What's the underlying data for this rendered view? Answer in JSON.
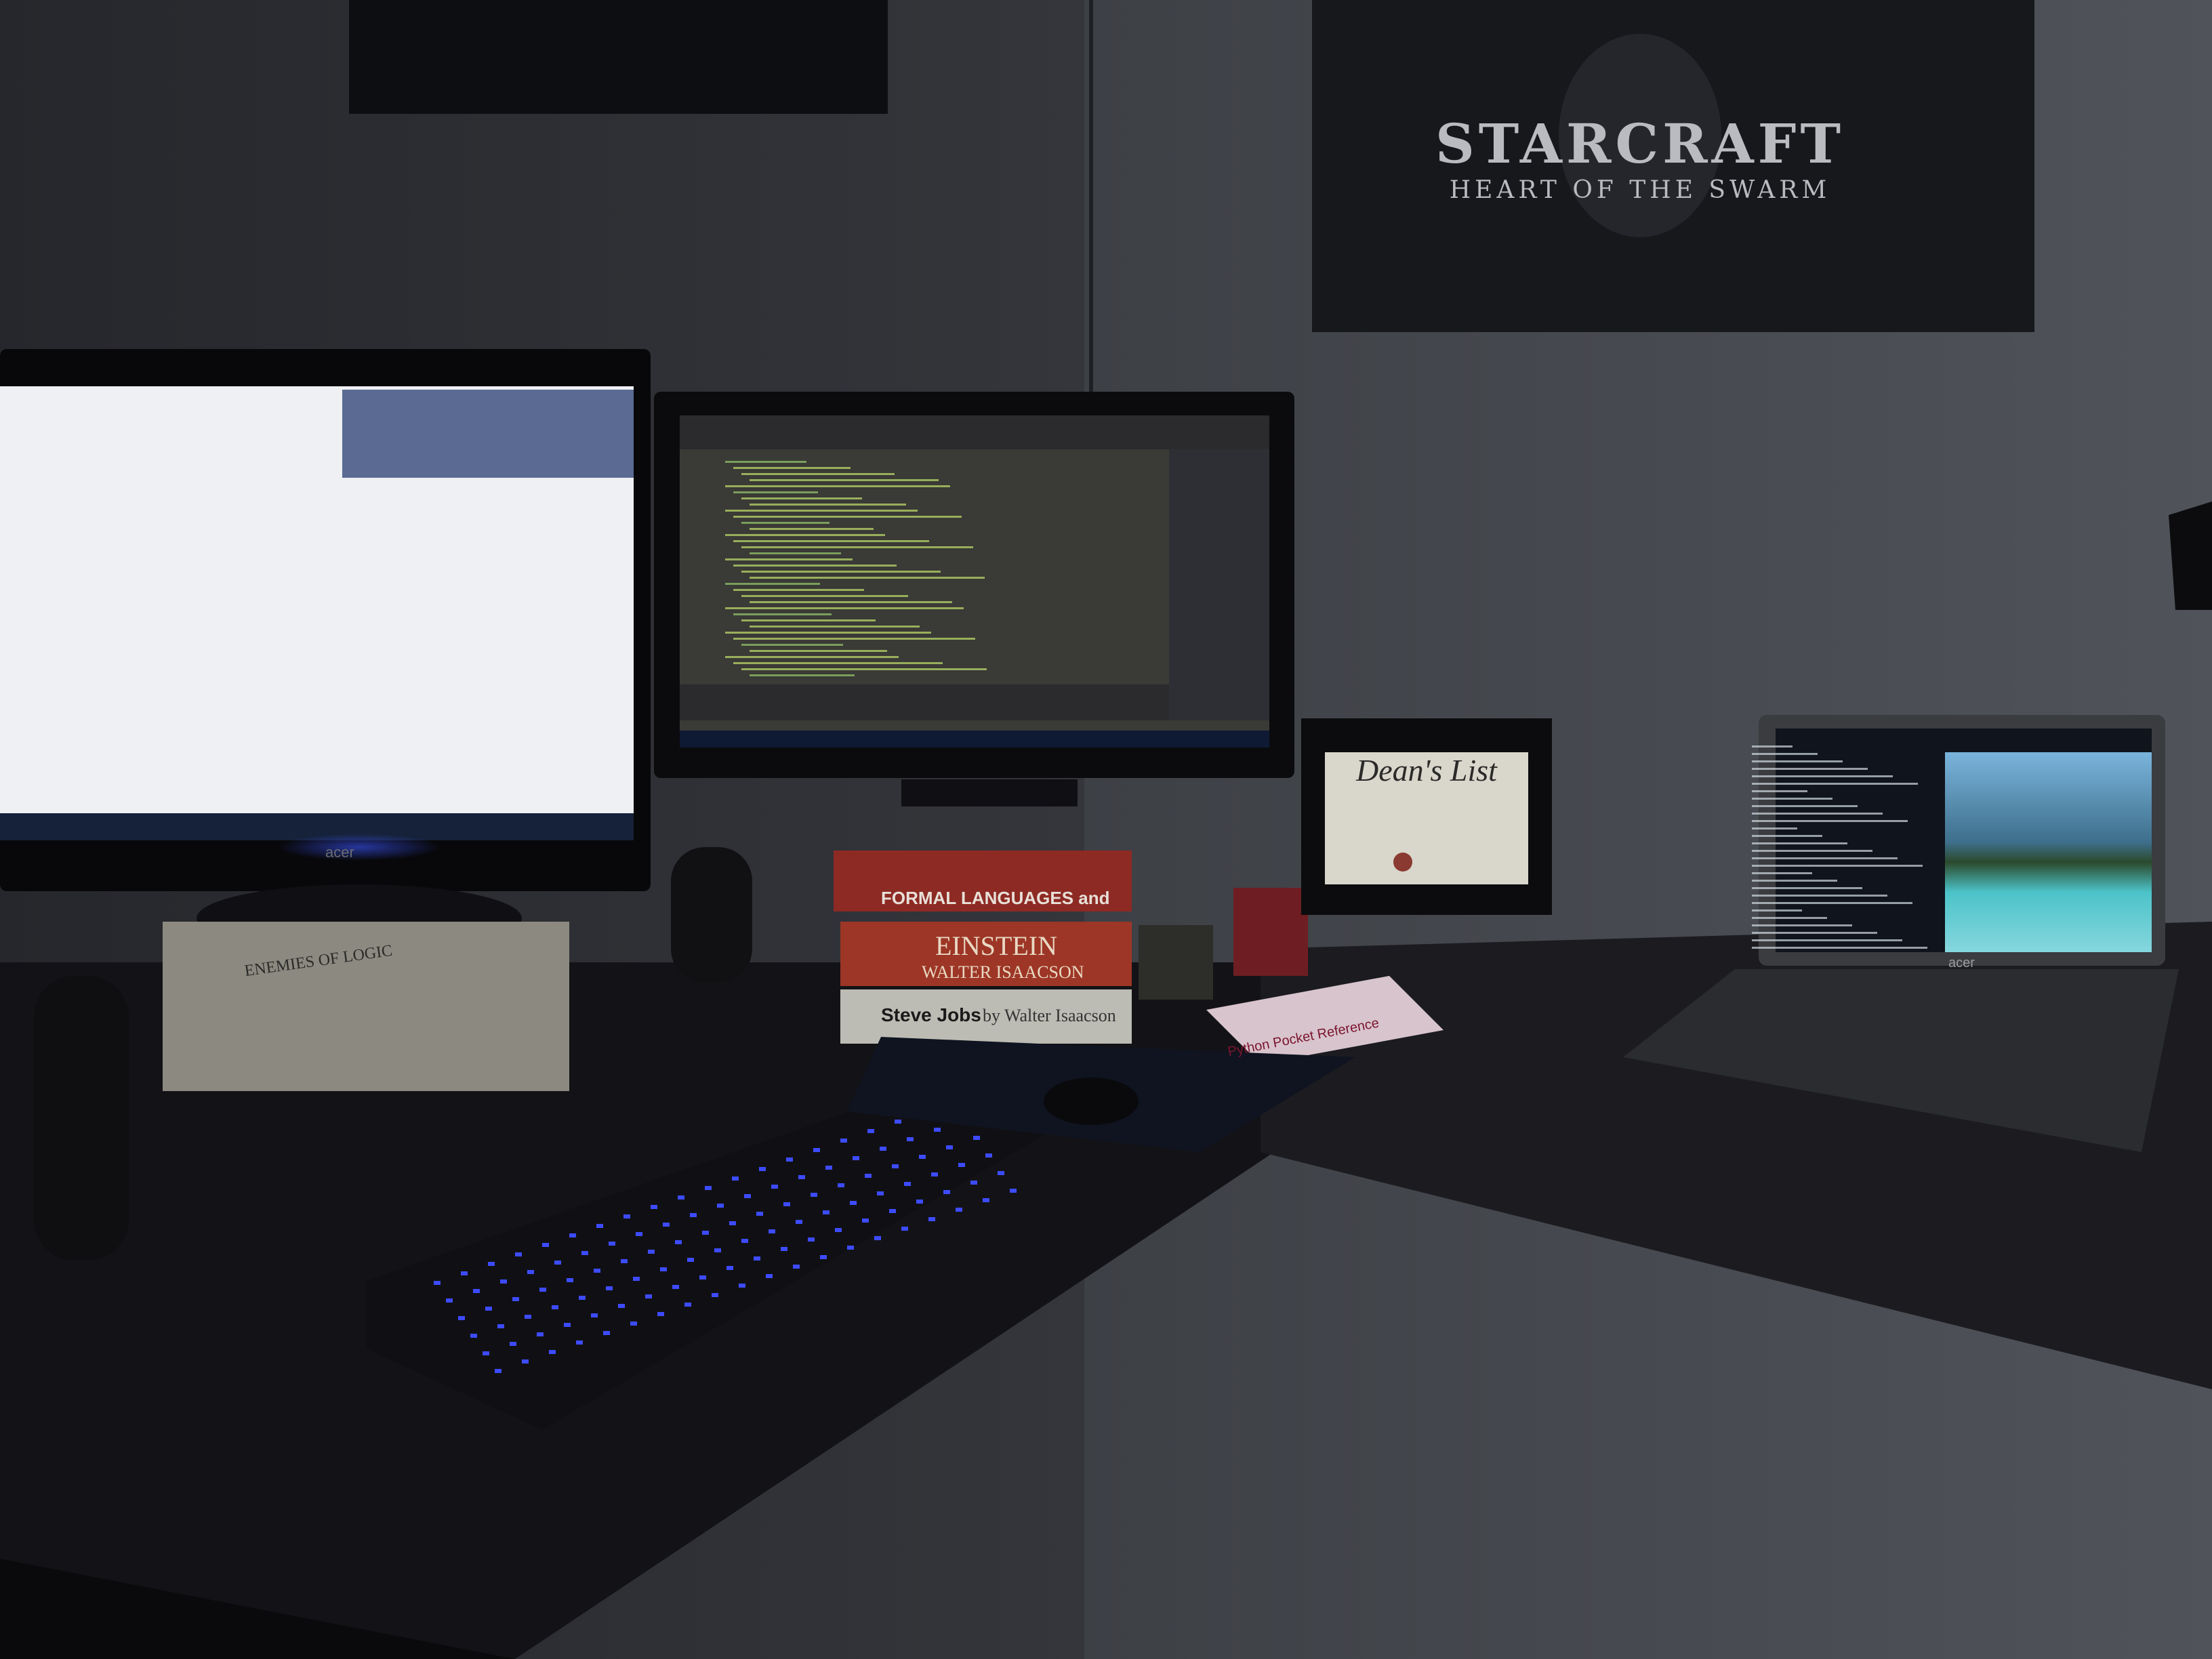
{
  "poster": {
    "title": "STARCRAFT",
    "subtitle": "HEART OF THE SWARM"
  },
  "certificate": {
    "title": "Dean's List"
  },
  "book_spines": {
    "formal_languages": "FORMAL LANGUAGES and",
    "einstein": "EINSTEIN",
    "einstein_author": "WALTER ISAACSON",
    "steve_jobs": "Steve Jobs",
    "steve_jobs_author": "by Walter Isaacson",
    "enemies_of_logic": "ENEMIES OF LOGIC",
    "python_ref": "Python Pocket Reference"
  },
  "brands": {
    "monitor_left": "acer",
    "laptop": "acer"
  },
  "colors": {
    "wall": "#2a2b30",
    "desk": "#141418",
    "keyboard_backlight": "#3d4bff",
    "ide_background": "#3a3a36",
    "ide_code": "#b8d66a",
    "taskbar": "#0e1a33"
  }
}
